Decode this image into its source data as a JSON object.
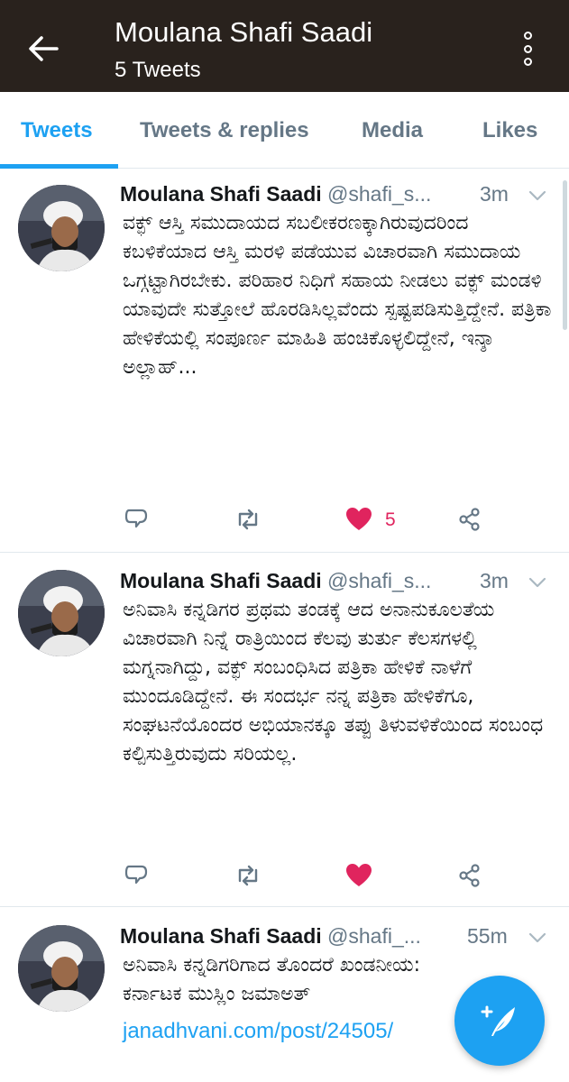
{
  "header": {
    "title": "Moulana Shafi Saadi",
    "subtitle": "5 Tweets",
    "back_icon": "arrow-left-icon",
    "more_icon": "more-vertical-icon",
    "background": "#29221d"
  },
  "tabs": [
    {
      "label": "Tweets",
      "active": true
    },
    {
      "label": "Tweets & replies",
      "active": false
    },
    {
      "label": "Media",
      "active": false
    },
    {
      "label": "Likes",
      "active": false
    }
  ],
  "accent_color": "#1da1f2",
  "like_color": "#e0245e",
  "tweets": [
    {
      "name": "Moulana Shafi Saadi",
      "handle": "@shafi_s...",
      "time": "3m",
      "text": "ವಕ್ಫ್ ಆಸ್ತಿ ಸಮುದಾಯದ ಸಬಲೀಕರಣಕ್ಕಾಗಿರುವುದರಿಂದ ಕಬಳಿಕೆಯಾದ ಆಸ್ತಿ ಮರಳಿ ಪಡೆಯುವ ವಿಚಾರವಾಗಿ ಸಮುದಾಯ ಒಗ್ಗಟ್ಟಾಗಿರಬೇಕು. ಪರಿಹಾರ ನಿಧಿಗೆ ಸಹಾಯ ನೀಡಲು ವಕ್ಫ್ ಮಂಡಳಿ ಯಾವುದೇ ಸುತ್ತೋಲೆ ಹೊರಡಿಸಿಲ್ಲವೆಂದು ಸ್ಪಷ್ಟಪಡಿಸುತ್ತಿದ್ದೇನೆ. ಪತ್ರಿಕಾ ಹೇಳಿಕೆಯಲ್ಲಿ ಸಂಪೂರ್ಣ ಮಾಹಿತಿ ಹಂಚಿಕೊಳ್ಳಲಿದ್ದೇನೆ, ಇನ್ಶಾ ಅಲ್ಲಾಹ್...",
      "likes": "5",
      "liked": true
    },
    {
      "name": "Moulana Shafi Saadi",
      "handle": "@shafi_s...",
      "time": "3m",
      "text": "ಅನಿವಾಸಿ ಕನ್ನಡಿಗರ ಪ್ರಥಮ ತಂಡಕ್ಕೆ ಆದ ಅನಾನುಕೂಲತೆಯ ವಿಚಾರವಾಗಿ ನಿನ್ನೆ ರಾತ್ರಿಯಿಂದ ಕೆಲವು ತುರ್ತು ಕೆಲಸಗಳಲ್ಲಿ ಮಗ್ನನಾಗಿದ್ದು, ವಕ್ಫ್ ಸಂಬಂಧಿಸಿದ ಪತ್ರಿಕಾ ಹೇಳಿಕೆ ನಾಳೆಗೆ ಮುಂದೂಡಿದ್ದೇನೆ. ಈ ಸಂದರ್ಭ ನನ್ನ ಪತ್ರಿಕಾ ಹೇಳಿಕೆಗೂ, ಸಂಘಟನೆಯೊಂದರ ಅಭಿಯಾನಕ್ಕೂ ತಪ್ಪು ತಿಳುವಳಿಕೆಯಿಂದ ಸಂಬಂಧ ಕಲ್ಪಿಸುತ್ತಿರುವುದು ಸರಿಯಲ್ಲ.",
      "likes": "",
      "liked": true
    },
    {
      "name": "Moulana Shafi Saadi",
      "handle": "@shafi_...",
      "time": "55m",
      "text": "ಅನಿವಾಸಿ ಕನ್ನಡಿಗರಿಗಾದ ತೊಂದರೆ ಖಂಡನೀಯ: ಕರ್ನಾಟಕ ಮುಸ್ಲಿಂ ಜಮಾಅತ್",
      "link": "janadhvani.com/post/24505/"
    }
  ],
  "fab_icon": "compose-tweet-icon"
}
